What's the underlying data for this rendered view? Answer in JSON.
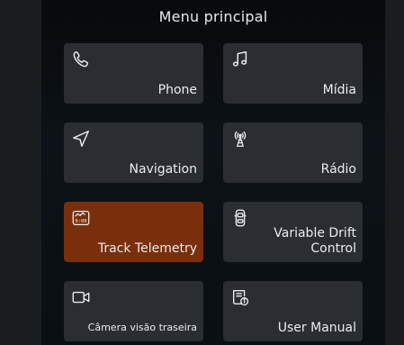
{
  "header": {
    "title": "Menu principal"
  },
  "tiles": [
    {
      "label": "Phone",
      "icon": "phone-icon"
    },
    {
      "label": "Mídia",
      "icon": "music-icon"
    },
    {
      "label": "Navigation",
      "icon": "navigation-arrow-icon"
    },
    {
      "label": "Rádio",
      "icon": "radio-tower-icon"
    },
    {
      "label": "Track Telemetry",
      "icon": "telemetry-gauge-icon",
      "active": true
    },
    {
      "label": "Variable Drift\nControl",
      "icon": "car-top-view-icon"
    },
    {
      "label": "Câmera visão traseira",
      "icon": "camera-icon"
    },
    {
      "label": "User Manual",
      "icon": "manual-info-icon"
    }
  ],
  "colors": {
    "tile_bg": "#2a2e32",
    "tile_active_bg": "#7a2f0c",
    "text": "#e9ecef"
  }
}
